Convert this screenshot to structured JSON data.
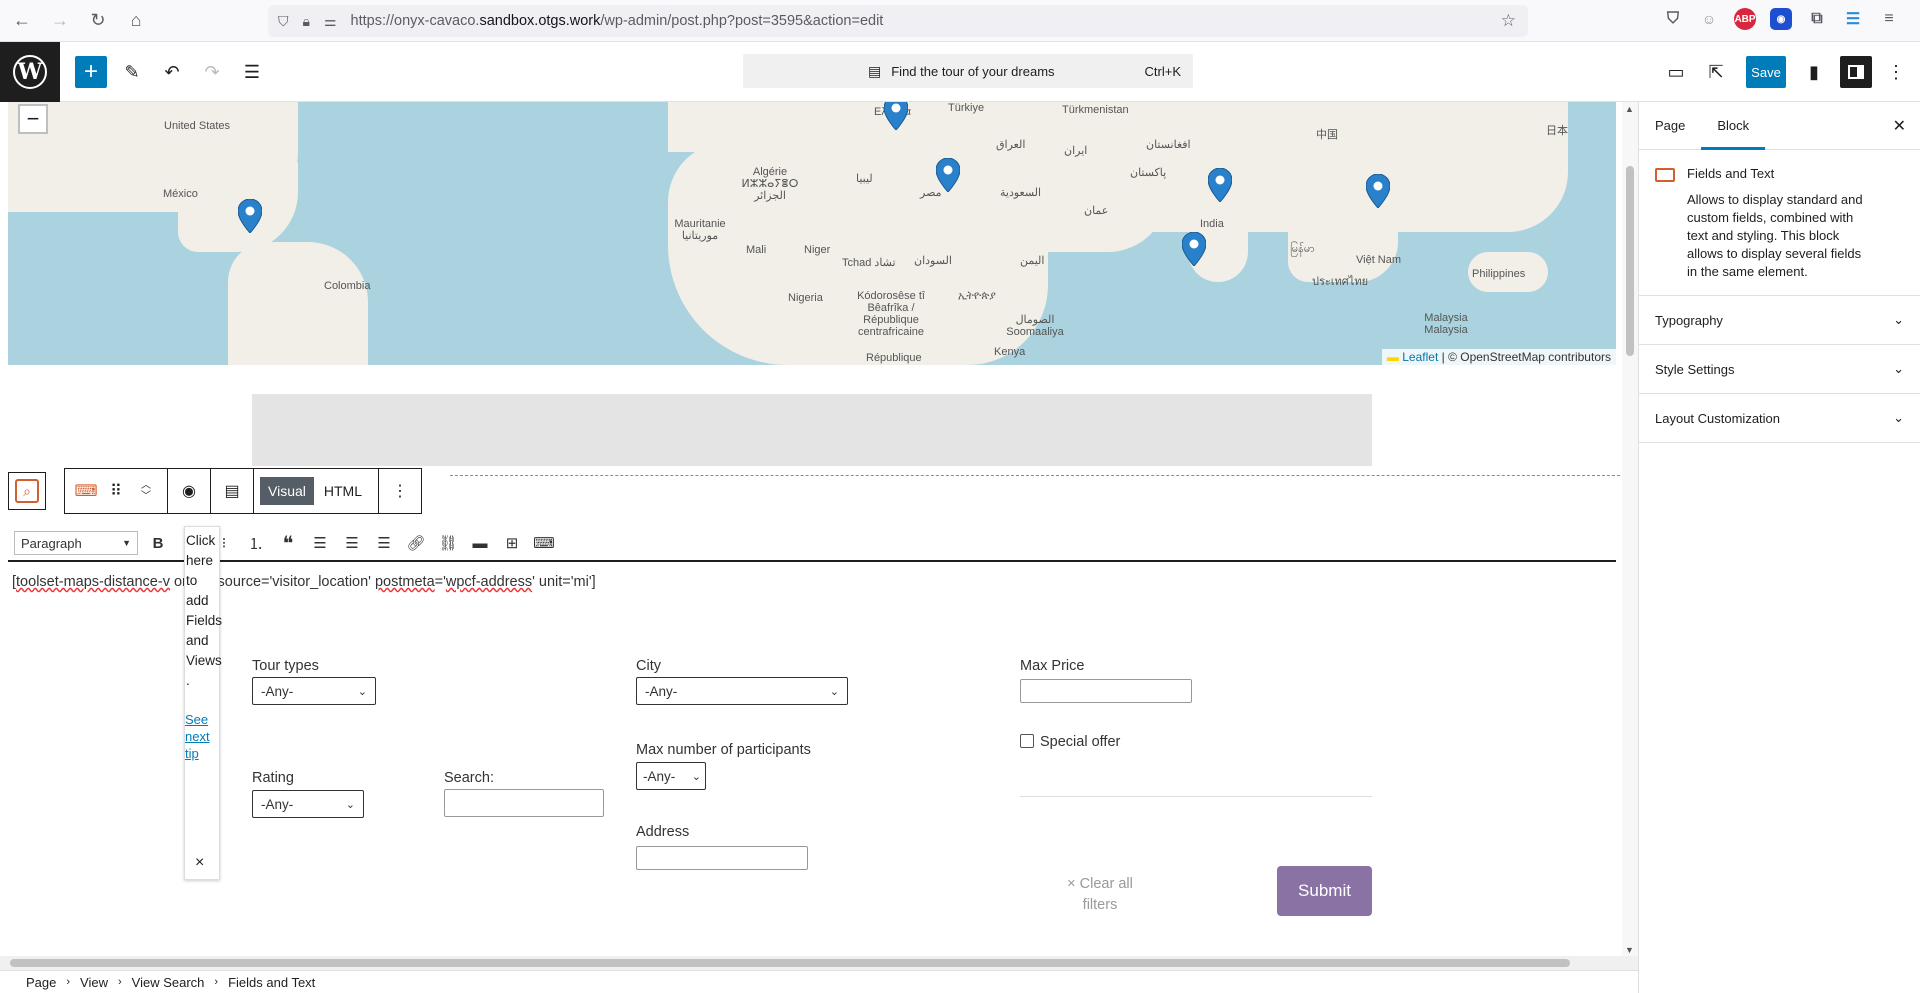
{
  "browser": {
    "url_prefix": "https://onyx-cavaco.",
    "url_domain": "sandbox.otgs.work",
    "url_suffix": "/wp-admin/post.php?post=3595&action=edit"
  },
  "toolbar": {
    "doc_title": "Find the tour of your dreams",
    "shortcut": "Ctrl+K",
    "save_label": "Save"
  },
  "map": {
    "labels": [
      "United States",
      "México",
      "Colombia",
      "Algérie ⵍⵣⵣⴰⵢⴻⵔ الجزائر",
      "Mauritanie موريتانيا",
      "Mali",
      "Niger",
      "Tchad تشاد",
      "Nigeria",
      "ليبيا",
      "مصر",
      "السودان",
      "Kódorosêse tî Bêafrîka / République centrafricaine",
      "ኢትዮጵያ",
      "الصومال Soomaaliya",
      "Kenya",
      "République",
      "Türkiye",
      "العراق",
      "السعودية",
      "ایران",
      "عمان",
      "اليمن",
      "Türkmenistan",
      "افغانستان",
      "پاکستان",
      "India",
      "中国",
      "日本",
      "Việt Nam",
      "ประเทศไทย",
      "မြန်မာ",
      "Philippines",
      "Malaysia Malaysia",
      "Ελλάδα"
    ],
    "zoom_out": "−",
    "attribution_link": "Leaflet",
    "attribution_text": " | © OpenStreetMap contributors"
  },
  "block_toolbar": {
    "visual_label": "Visual",
    "html_label": "HTML"
  },
  "editor": {
    "format_select": "Paragraph",
    "content_a": "[",
    "content_b": "toolset-maps-distance-v",
    "content_c": " origin_source='visitor_location' ",
    "content_d": "postmeta",
    "content_e": "='",
    "content_f": "wpcf-address",
    "content_g": "' unit='mi']"
  },
  "tip": {
    "text": "Click here to add Fields and Views.",
    "link": "See next tip",
    "close": "×"
  },
  "form": {
    "tour_types_label": "Tour types",
    "tour_types_value": "-Any-",
    "city_label": "City",
    "city_value": "-Any-",
    "max_price_label": "Max Price",
    "special_offer_label": "Special offer",
    "rating_label": "Rating",
    "rating_value": "-Any-",
    "search_label": "Search:",
    "max_participants_label": "Max number of participants",
    "max_participants_value": "-Any-",
    "address_label": "Address",
    "clear_filters": "× Clear all filters",
    "submit": "Submit"
  },
  "breadcrumb": [
    "Page",
    "View",
    "View Search",
    "Fields and Text"
  ],
  "sidebar": {
    "tab_page": "Page",
    "tab_block": "Block",
    "block_title": "Fields and Text",
    "block_desc": "Allows to display standard and custom fields, combined with text and styling. This block allows to display several fields in the same element.",
    "panels": [
      "Typography",
      "Style Settings",
      "Layout Customization"
    ]
  }
}
